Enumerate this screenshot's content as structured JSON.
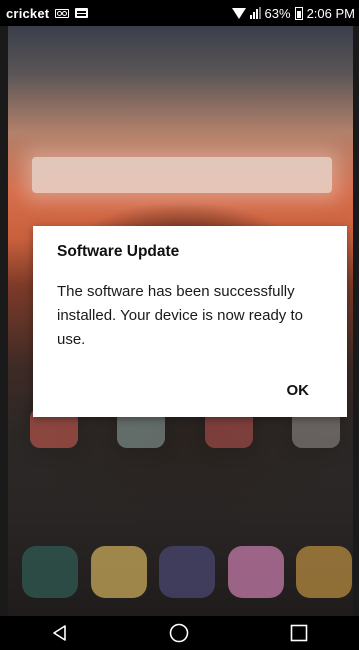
{
  "status_bar": {
    "carrier": "cricket",
    "battery": "63%",
    "time": "2:06 PM",
    "icons": [
      "voicemail-icon",
      "message-icon",
      "wifi-icon",
      "signal-icon",
      "battery-icon"
    ]
  },
  "dialog": {
    "title": "Software Update",
    "message": "The software has been successfully installed. Your device is now ready to use.",
    "ok_label": "OK"
  },
  "nav_bar": {
    "icons": [
      "back-icon",
      "home-icon",
      "recents-icon"
    ]
  },
  "colors": {
    "status_bar_bg": "#000000",
    "dialog_bg": "#ffffff",
    "nav_bar_bg": "#000000"
  }
}
